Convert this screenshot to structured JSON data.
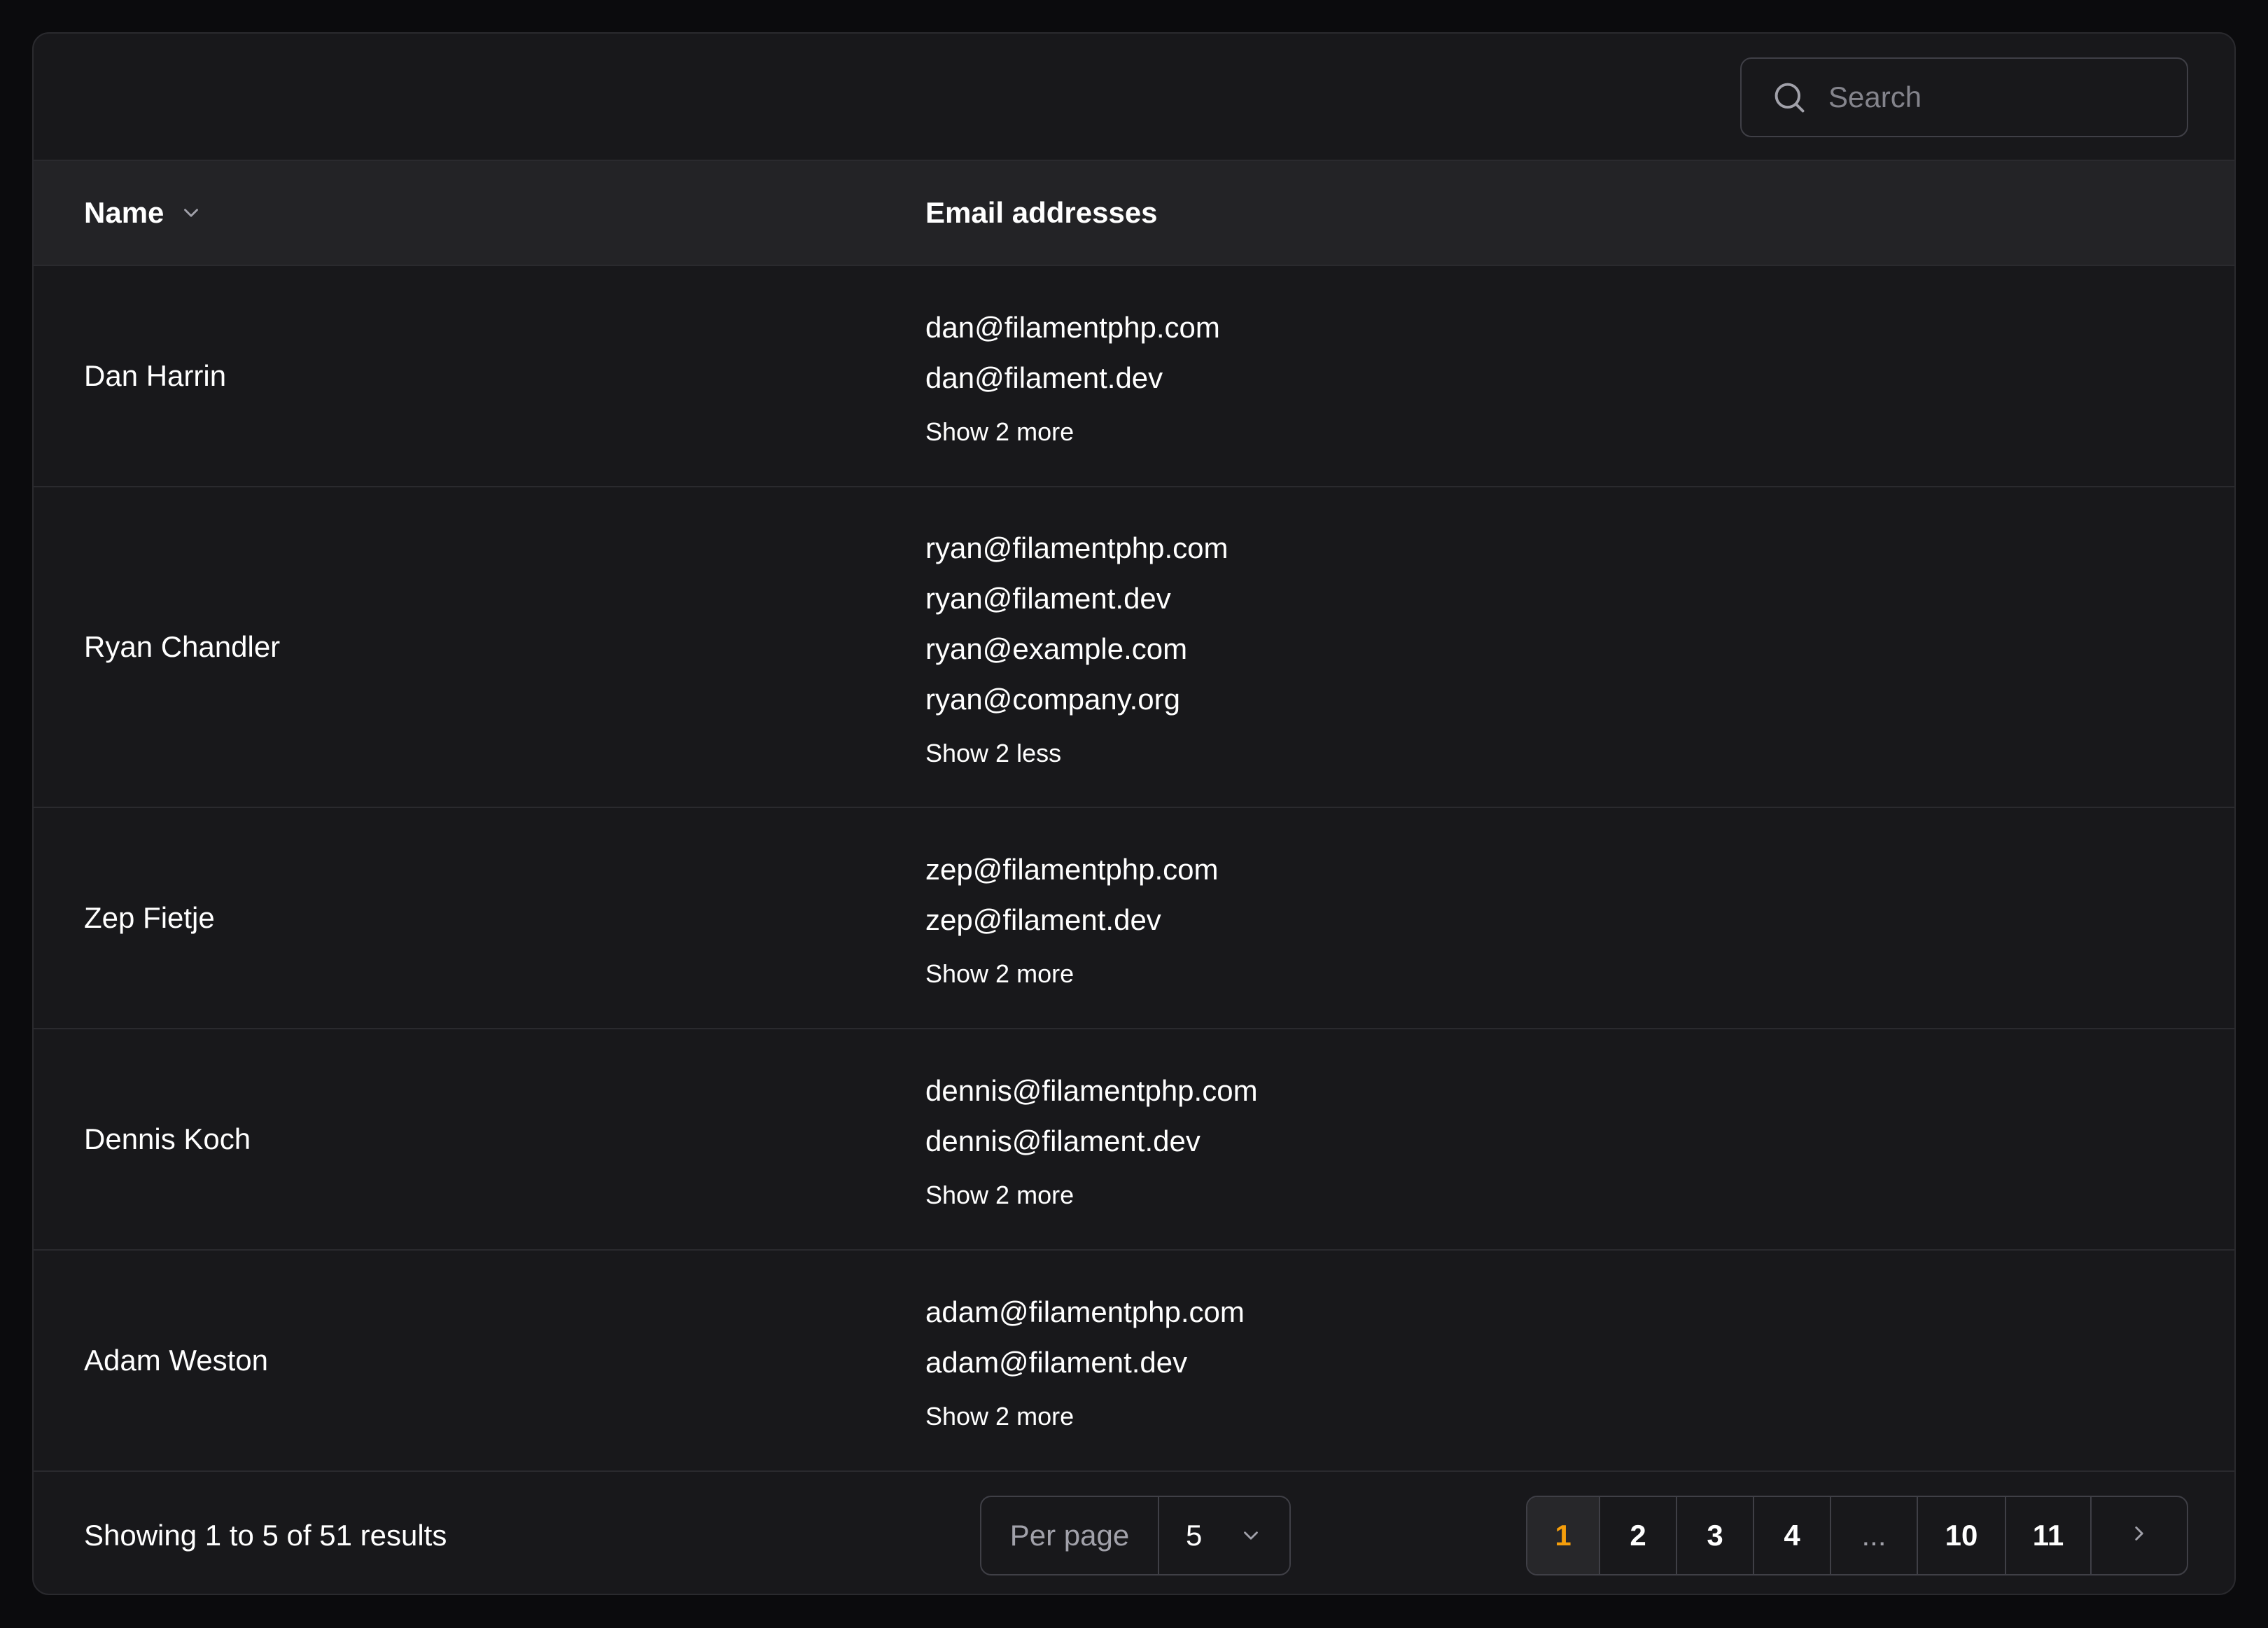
{
  "search": {
    "placeholder": "Search"
  },
  "table": {
    "columns": {
      "name": "Name",
      "emails": "Email addresses"
    },
    "rows": [
      {
        "name": "Dan Harrin",
        "emails": [
          "dan@filamentphp.com",
          "dan@filament.dev"
        ],
        "toggle": "Show 2 more"
      },
      {
        "name": "Ryan Chandler",
        "emails": [
          "ryan@filamentphp.com",
          "ryan@filament.dev",
          "ryan@example.com",
          "ryan@company.org"
        ],
        "toggle": "Show 2 less"
      },
      {
        "name": "Zep Fietje",
        "emails": [
          "zep@filamentphp.com",
          "zep@filament.dev"
        ],
        "toggle": "Show 2 more"
      },
      {
        "name": "Dennis Koch",
        "emails": [
          "dennis@filamentphp.com",
          "dennis@filament.dev"
        ],
        "toggle": "Show 2 more"
      },
      {
        "name": "Adam Weston",
        "emails": [
          "adam@filamentphp.com",
          "adam@filament.dev"
        ],
        "toggle": "Show 2 more"
      }
    ]
  },
  "footer": {
    "summary": "Showing 1 to 5 of 51 results",
    "per_page_label": "Per page",
    "per_page_value": "5",
    "pages": [
      "1",
      "2",
      "3",
      "4",
      "...",
      "10",
      "11"
    ],
    "active_page": "1"
  },
  "colors": {
    "background": "#0b0b0d",
    "card": "#18181b",
    "header_row": "#232326",
    "active_page": "#f59e0b"
  },
  "icons": {
    "search": "search-icon",
    "sort": "chevron-down-icon",
    "select": "chevron-down-icon",
    "next": "chevron-right-icon"
  }
}
